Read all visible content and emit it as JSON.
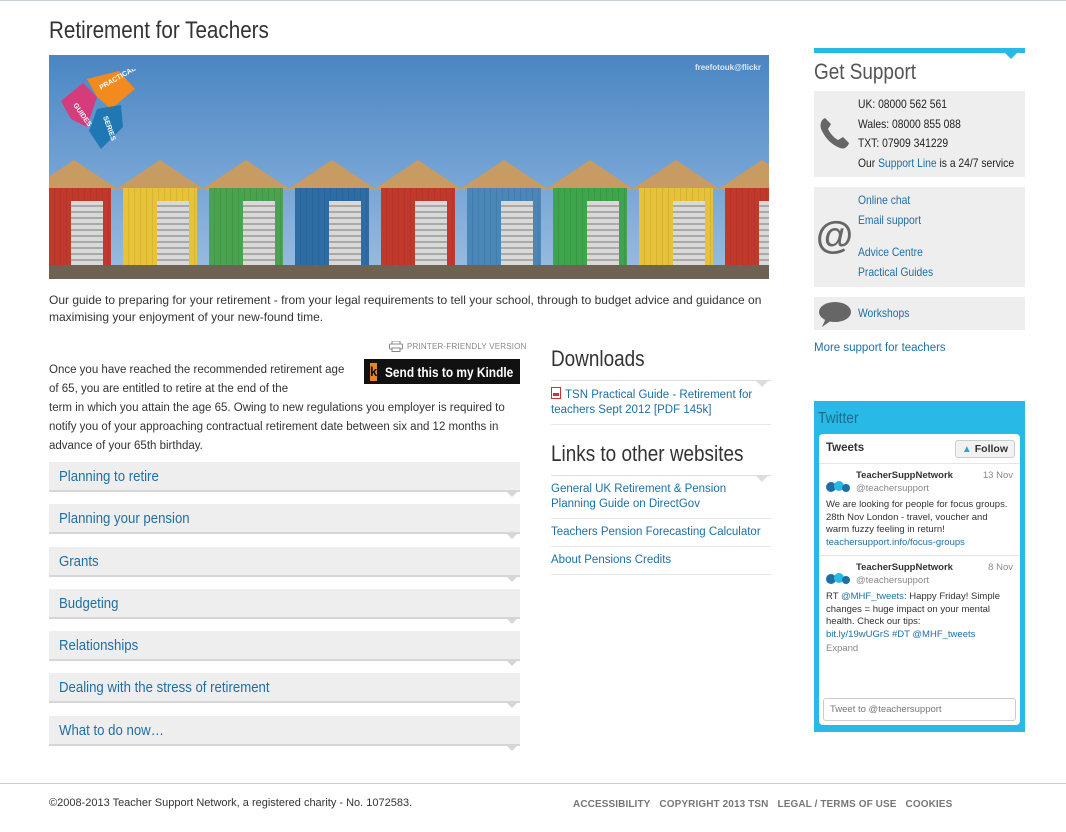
{
  "page": {
    "title": "Retirement for Teachers"
  },
  "hero": {
    "credit": "freefotouk@flickr",
    "badge_words": [
      "PRACTICAL",
      "GUIDES",
      "SERIES"
    ],
    "hut_colors": [
      "#c0392b",
      "#e8c33a",
      "#4aa34f",
      "#2e6da4",
      "#c0392b",
      "#4a86b8",
      "#3fa54a",
      "#e6c13a",
      "#c0392b"
    ]
  },
  "intro": "Our guide to preparing for your retirement - from your legal requirements to tell your school, through to budget advice and guidance on maximising your enjoyment of your new-found time.",
  "printer_label": "PRINTER-FRIENDLY VERSION",
  "kindle": {
    "letter": "k",
    "label": "Send this to my Kindle"
  },
  "body": {
    "part1": "Once you have reached the recommended retirement age of 65, you are entitled to retire at the end of the",
    "part2": "term in which you attain the age 65. Owing to new regulations you employer is required to notify you of your approaching contractual retirement date between six and 12 months in advance of your 65th birthday."
  },
  "accordion": [
    "Planning to retire",
    "Planning your pension",
    "Grants",
    "Budgeting",
    "Relationships",
    "Dealing with the stress of retirement",
    "What to do now…"
  ],
  "downloads": {
    "heading": "Downloads",
    "file_label": "TSN Practical Guide - Retirement for teachers Sept 2012 [PDF 145k]"
  },
  "links": {
    "heading": "Links to other websites",
    "items": [
      "General UK Retirement & Pension Planning Guide on DirectGov",
      "Teachers Pension Forecasting Calculator",
      "About Pensions Credits"
    ]
  },
  "support": {
    "heading": "Get Support",
    "uk": "UK: 08000 562 561",
    "wales": "Wales: 08000 855 088",
    "txt": "TXT: 07909 341229",
    "line_prefix": "Our",
    "line_link": "Support Line",
    "line_suffix": "is a 24/7 service",
    "online_chat": "Online chat",
    "email_support": "Email support",
    "advice_centre": "Advice Centre",
    "practical_guides": "Practical Guides",
    "workshops": "Workshops",
    "more": "More support for teachers"
  },
  "twitter": {
    "heading": "Twitter",
    "panel_title": "Tweets",
    "follow": "Follow",
    "tweets": [
      {
        "name": "TeacherSuppNetwork",
        "handle": "@teachersupport",
        "date": "13 Nov",
        "text": "We are looking for people for focus groups. 28th Nov London - travel, voucher and warm fuzzy feeling in return!",
        "link": "teachersupport.info/focus-groups"
      },
      {
        "name": "TeacherSuppNetwork",
        "handle": "@teachersupport",
        "date": "8 Nov",
        "rt": "RT",
        "mention": "@MHF_tweets",
        "text": ": Happy Friday! Simple changes = huge impact on your mental health. Check our tips:",
        "link": "bit.ly/19wUGrS #DT @MHF_tweets",
        "expand": "Expand"
      }
    ],
    "compose_placeholder": "Tweet to @teachersupport"
  },
  "footer": {
    "copyright": "©2008-2013 Teacher Support Network, a registered charity - No. 1072583.",
    "links": [
      "ACCESSIBILITY",
      "COPYRIGHT 2013 TSN",
      "LEGAL / TERMS OF USE",
      "COOKIES"
    ]
  },
  "colors": {
    "accent": "#29b9e6",
    "link": "#1e6fa5"
  }
}
